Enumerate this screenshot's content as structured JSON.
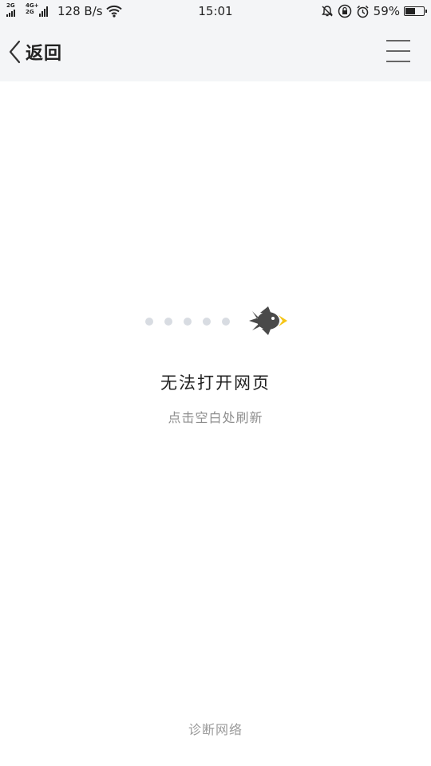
{
  "status_bar": {
    "sim1_network": "2G",
    "sim2_network_top": "4G+",
    "sim2_network_bottom": "2G",
    "net_speed": "128 B/s",
    "time": "15:01",
    "battery_percent_label": "59%",
    "battery_level": 0.59,
    "icons": [
      "signal-icon",
      "wifi-icon",
      "mute-icon",
      "rotation-lock-icon",
      "alarm-icon",
      "battery-icon"
    ]
  },
  "nav": {
    "back_label": "返回",
    "back_icon": "chevron-left-icon",
    "menu_icon": "hamburger-menu-icon"
  },
  "error": {
    "illustration": "bird-icon",
    "accent_color": "#f5c518",
    "title": "无法打开网页",
    "hint": "点击空白处刷新"
  },
  "footer": {
    "diagnose_label": "诊断网络"
  }
}
